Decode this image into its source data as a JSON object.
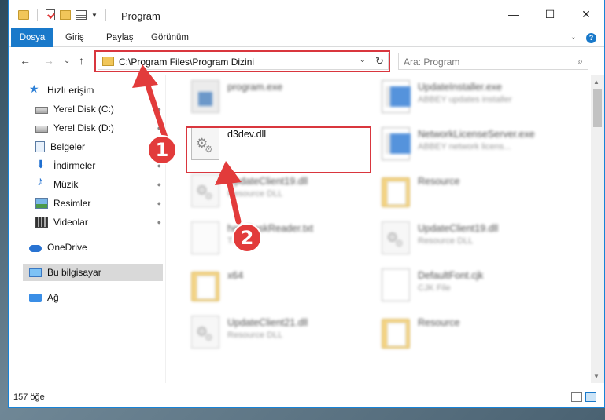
{
  "window": {
    "title": "Program",
    "controls": {
      "minimize": "—",
      "maximize": "☐",
      "close": "✕"
    }
  },
  "ribbon": {
    "tabs": [
      "Dosya",
      "Giriş",
      "Paylaş",
      "Görünüm"
    ],
    "expand_glyph": "⌄",
    "help_glyph": "?"
  },
  "navbar": {
    "back": "←",
    "forward": "→",
    "recent": "⌄",
    "up": "↑",
    "address": "C:\\Program Files\\Program Dizini",
    "address_dropdown": "⌄",
    "refresh": "↻",
    "search_placeholder": "Ara: Program",
    "search_icon": "⌕"
  },
  "sidebar": {
    "items": [
      {
        "label": "Hızlı erişim",
        "icon": "star-icon"
      },
      {
        "label": "Yerel Disk (C:)",
        "icon": "disk-icon",
        "pinned": true
      },
      {
        "label": "Yerel Disk (D:)",
        "icon": "disk-icon",
        "pinned": true
      },
      {
        "label": "Belgeler",
        "icon": "document-icon",
        "pinned": true
      },
      {
        "label": "İndirmeler",
        "icon": "download-icon",
        "pinned": true
      },
      {
        "label": "Müzik",
        "icon": "music-icon",
        "pinned": true
      },
      {
        "label": "Resimler",
        "icon": "pictures-icon",
        "pinned": true
      },
      {
        "label": "Videolar",
        "icon": "video-icon",
        "pinned": true
      },
      {
        "label": "OneDrive",
        "icon": "cloud-icon"
      },
      {
        "label": "Bu bilgisayar",
        "icon": "computer-icon",
        "selected": true
      },
      {
        "label": "Ağ",
        "icon": "network-icon"
      }
    ],
    "pin_glyph": "📌"
  },
  "files": [
    {
      "name": "program.exe",
      "sub": "",
      "icon": "program-icon",
      "blurred": true
    },
    {
      "name": "UpdateInstaller.exe",
      "sub": "ABBEY updates installer",
      "icon": "exe-icon",
      "blurred": true
    },
    {
      "name": "d3dev.dll",
      "sub": "",
      "icon": "dll-icon",
      "blurred": false
    },
    {
      "name": "NetworkLicenseServer.exe",
      "sub": "ABBEY network licens...",
      "icon": "exe-icon",
      "blurred": true
    },
    {
      "name": "UpdateClient19.dll",
      "sub": "Resource DLL",
      "icon": "dll-icon",
      "blurred": true
    },
    {
      "name": "Resource",
      "sub": "",
      "icon": "folder-icon",
      "blurred": true
    },
    {
      "name": "helpDeskReader.txt",
      "sub": "TXT",
      "icon": "text-file-icon",
      "blurred": true
    },
    {
      "name": "UpdateClient19.dll",
      "sub": "Resource DLL",
      "icon": "dll-icon",
      "blurred": true
    },
    {
      "name": "x64",
      "sub": "",
      "icon": "folder-icon",
      "blurred": true
    },
    {
      "name": "DefaultFont.cjk",
      "sub": "CJK File",
      "icon": "cjk-file-icon",
      "blurred": true
    },
    {
      "name": "UpdateClient21.dll",
      "sub": "Resource DLL",
      "icon": "dll-icon",
      "blurred": true
    },
    {
      "name": "Resource",
      "sub": "",
      "icon": "folder-icon",
      "blurred": true
    }
  ],
  "annotations": {
    "step1": "1",
    "step2": "2",
    "arrow_color": "#e23b3b"
  },
  "status": {
    "count": "157 öğe"
  },
  "colors": {
    "accent": "#1979ca",
    "highlight": "#d9363e",
    "folder": "#f1c65a"
  }
}
